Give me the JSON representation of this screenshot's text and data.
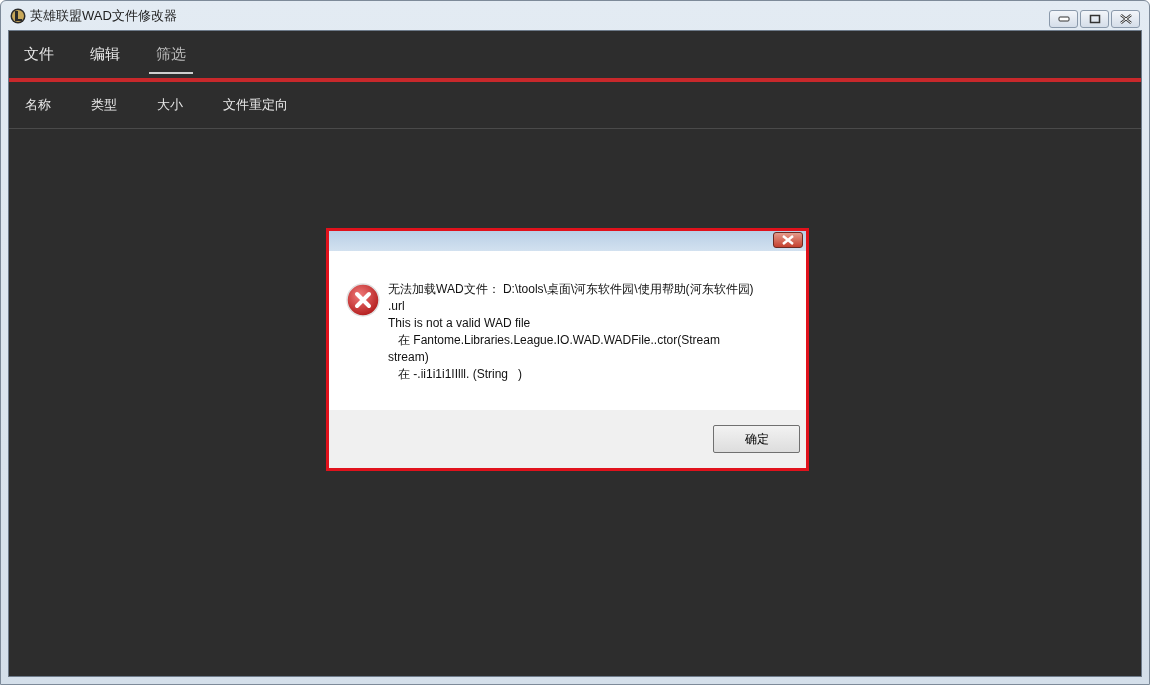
{
  "window": {
    "title": "英雄联盟WAD文件修改器"
  },
  "menu": [
    {
      "label": "文件",
      "selected": false
    },
    {
      "label": "编辑",
      "selected": false
    },
    {
      "label": "筛选",
      "selected": true
    }
  ],
  "table": {
    "columns": [
      "名称",
      "类型",
      "大小",
      "文件重定向"
    ]
  },
  "dialog": {
    "message_lines": [
      "无法加载WAD文件： D:\\tools\\桌面\\河东软件园\\使用帮助(河东软件园)",
      ".url",
      "This is not a valid WAD file",
      "   在 Fantome.Libraries.League.IO.WAD.WADFile..ctor(Stream",
      "stream)",
      "   在 -.ii1i1i1IIlll. (String   )"
    ],
    "kind": "error",
    "highlighted": true,
    "buttons": [
      "确定"
    ]
  }
}
